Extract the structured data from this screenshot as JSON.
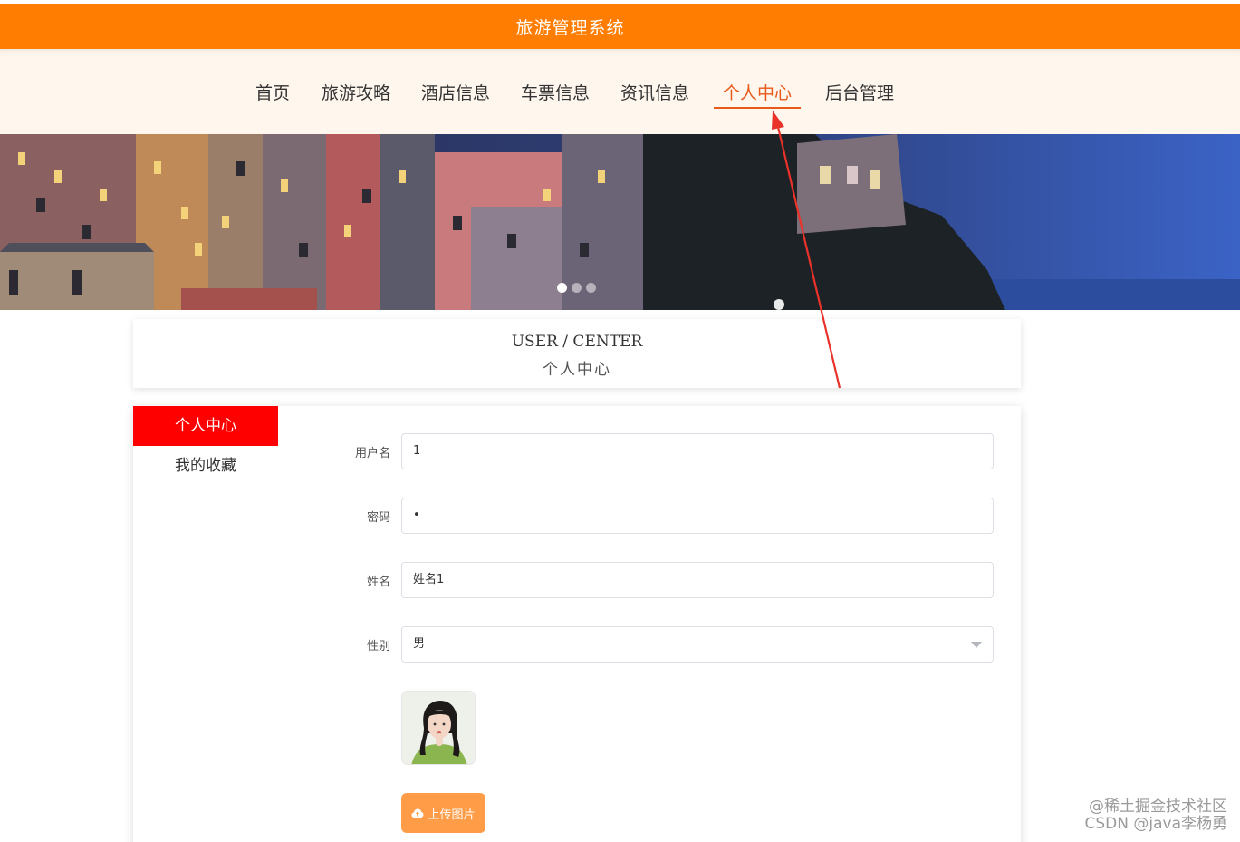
{
  "header": {
    "title": "旅游管理系统"
  },
  "nav": {
    "items": [
      {
        "label": "首页"
      },
      {
        "label": "旅游攻略"
      },
      {
        "label": "酒店信息"
      },
      {
        "label": "车票信息"
      },
      {
        "label": "资讯信息"
      },
      {
        "label": "个人中心",
        "active": true
      },
      {
        "label": "后台管理"
      }
    ]
  },
  "banner": {
    "slide_count": 3,
    "active_slide": 1
  },
  "section": {
    "title_en": "USER / CENTER",
    "title_cn": "个人中心"
  },
  "side_menu": {
    "items": [
      {
        "label": "个人中心",
        "active": true
      },
      {
        "label": "我的收藏"
      }
    ]
  },
  "form": {
    "username": {
      "label": "用户名",
      "value": "1"
    },
    "password": {
      "label": "密码",
      "value": "•"
    },
    "name": {
      "label": "姓名",
      "value": "姓名1"
    },
    "gender": {
      "label": "性别",
      "value": "男"
    },
    "upload_label": "上传图片"
  },
  "watermark": {
    "line1": "@稀土掘金技术社区",
    "line2": "CSDN @java李杨勇"
  },
  "colors": {
    "header_orange": "#ff7d00",
    "active_nav": "#e85a1a",
    "side_active": "#ff0000",
    "upload_btn": "#ff9c47"
  }
}
